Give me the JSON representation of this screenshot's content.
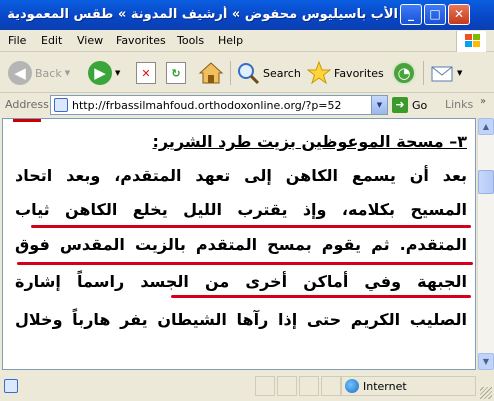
{
  "window": {
    "title": "الأب باسيليوس محفوض » أرشيف المدونة » طقس المعمودية عند يوح",
    "buttons": [
      "_",
      "□",
      "✕"
    ]
  },
  "menu": [
    "File",
    "Edit",
    "View",
    "Favorites",
    "Tools",
    "Help"
  ],
  "toolbar": {
    "back": "Back",
    "search": "Search",
    "favorites": "Favorites"
  },
  "address": {
    "label": "Address",
    "url": "http://frbassilmahfoud.orthodoxonline.org/?p=52",
    "go": "Go",
    "links": "Links"
  },
  "article": {
    "heading": "٣– مسحة الموعوظين بزيت طرد الشرير:",
    "lines": [
      "بعد أن يسمع الكاهن إلى تعهد المتقدم، وبعد اتحاد",
      "المسيح بكلامه، وإذ يقترب الليل يخلع الكاهن ثياب",
      "المتقدم. ثم يقوم بمسح المتقدم بالزيت المقدس فوق",
      "الجبهة وفي أماكن أخرى من الجسد راسماً إشارة",
      "الصليب الكريم حتى إذا رآها الشيطان يفر هارباً وخلال"
    ]
  },
  "status": {
    "zone": "Internet"
  },
  "colors": {
    "titlebar": "#0a4fd0",
    "underline": "#d4001a"
  }
}
